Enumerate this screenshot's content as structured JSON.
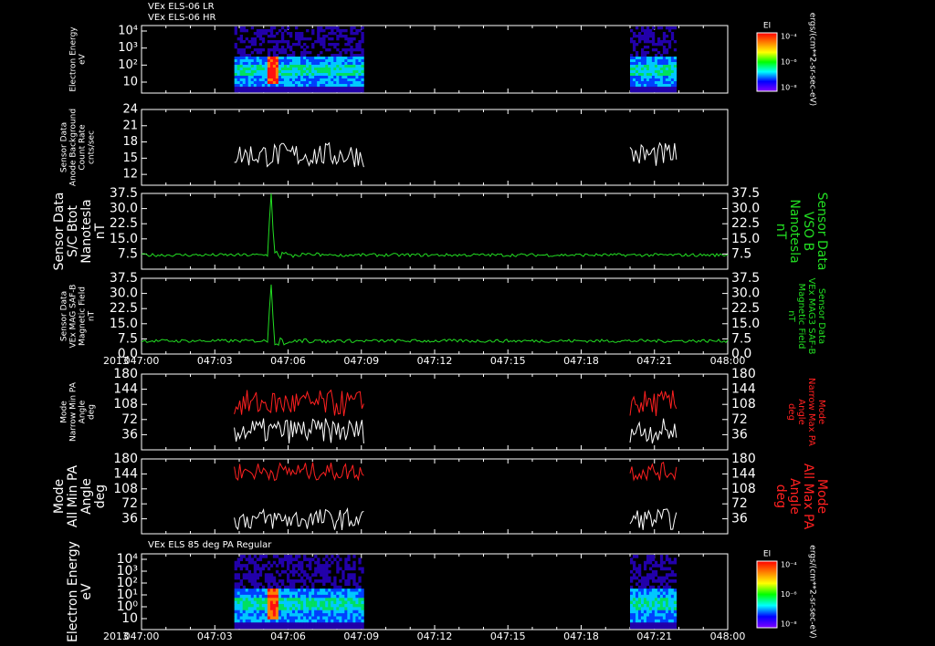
{
  "header": {
    "line1": "VEx ELS-06 LR",
    "line2": "VEx ELS-06 HR",
    "bottom_title": "VEx ELS 85 deg PA Regular"
  },
  "time_axis": {
    "year": "2013",
    "ticks": [
      "047:00",
      "047:03",
      "047:06",
      "047:09",
      "047:12",
      "047:15",
      "047:18",
      "047:21",
      "048:00"
    ]
  },
  "colorbar": {
    "title": "EI",
    "unit": "ergs/(cm**2-sr-sec-eV)",
    "ticks": [
      "10⁻⁴",
      "10⁻⁶",
      "10⁻⁸"
    ]
  },
  "chart_data": [
    {
      "type": "heatmap",
      "ylabel": [
        "Electron Energy",
        "eV"
      ],
      "y_scale": "log",
      "yticks": [
        "10⁴",
        "10³",
        "10²",
        "10"
      ],
      "data_windows": [
        [
          3.8,
          9.1
        ],
        [
          20.0,
          21.9
        ]
      ],
      "colorbar": true
    },
    {
      "type": "line",
      "ylabel": [
        "Sensor Data",
        "Anode Background",
        "Count Rate",
        "cnts/sec"
      ],
      "ylim": [
        10,
        24
      ],
      "yticks": [
        "24",
        "21",
        "18",
        "15",
        "12"
      ],
      "series": [
        {
          "color": "#ffffff",
          "windows": [
            [
              3.8,
              9.1
            ],
            [
              20.0,
              21.9
            ]
          ],
          "mean": 15.6,
          "jitter": 2.3
        }
      ]
    },
    {
      "type": "line",
      "ylabel": [
        "Sensor Data",
        "S/C Btot",
        "Nanotesla",
        "nT"
      ],
      "ylabel_right": [
        "Sensor Data",
        "VSO B",
        "Nanotesla",
        "nT"
      ],
      "ylim": [
        0,
        37.5
      ],
      "yticks": [
        "37.5",
        "30.0",
        "22.5",
        "15.0",
        "7.5"
      ],
      "series": [
        {
          "color": "#22dd22",
          "windows": [
            [
              0,
              24
            ]
          ],
          "baseline": 7.0,
          "spike_at": 5.3,
          "spike_value": 36.0
        }
      ]
    },
    {
      "type": "line",
      "ylabel": [
        "Sensor Data",
        "VEx MAG SAF-B",
        "Magnetic Field",
        "nT"
      ],
      "ylabel_right": [
        "Sensor Data",
        "VEx MAG3 SAF-B",
        "Magnetic Field",
        "nT"
      ],
      "ylim": [
        0,
        37.5
      ],
      "yticks": [
        "37.5",
        "30.0",
        "22.5",
        "15.0",
        "7.5",
        "0.0"
      ],
      "series": [
        {
          "color": "#22dd22",
          "windows": [
            [
              0,
              24
            ]
          ],
          "baseline": 6.5,
          "spike_at": 5.3,
          "spike_value": 33.0
        }
      ]
    },
    {
      "type": "line",
      "ylabel": [
        "Mode",
        "Narrow Min PA",
        "Angle",
        "deg"
      ],
      "ylabel_right": [
        "Mode",
        "Narrow Max PA",
        "Angle",
        "deg"
      ],
      "ylim": [
        0,
        180
      ],
      "yticks": [
        "180",
        "144",
        "108",
        "72",
        "36"
      ],
      "series": [
        {
          "color": "#ff2020",
          "windows": [
            [
              3.8,
              9.1
            ],
            [
              20.0,
              21.9
            ]
          ],
          "mean": 110,
          "jitter": 32
        },
        {
          "color": "#ffffff",
          "windows": [
            [
              3.8,
              9.1
            ],
            [
              20.0,
              21.9
            ]
          ],
          "mean": 45,
          "jitter": 30
        }
      ]
    },
    {
      "type": "line",
      "ylabel": [
        "Mode",
        "All Min PA",
        "Angle",
        "deg"
      ],
      "ylabel_right": [
        "Mode",
        "All Max PA",
        "Angle",
        "deg"
      ],
      "ylim": [
        0,
        180
      ],
      "yticks": [
        "180",
        "144",
        "108",
        "72",
        "36"
      ],
      "series": [
        {
          "color": "#ff2020",
          "windows": [
            [
              3.8,
              9.1
            ],
            [
              20.0,
              21.9
            ]
          ],
          "mean": 150,
          "jitter": 22
        },
        {
          "color": "#ffffff",
          "windows": [
            [
              3.8,
              9.1
            ],
            [
              20.0,
              21.9
            ]
          ],
          "mean": 35,
          "jitter": 26
        }
      ]
    },
    {
      "type": "heatmap",
      "ylabel": [
        "Electron Energy",
        "eV"
      ],
      "y_scale": "log",
      "yticks": [
        "10⁴",
        "10³",
        "10²",
        "10¹",
        "10⁰",
        "10"
      ],
      "data_windows": [
        [
          3.8,
          9.1
        ],
        [
          20.0,
          21.9
        ]
      ],
      "colorbar": true
    }
  ]
}
